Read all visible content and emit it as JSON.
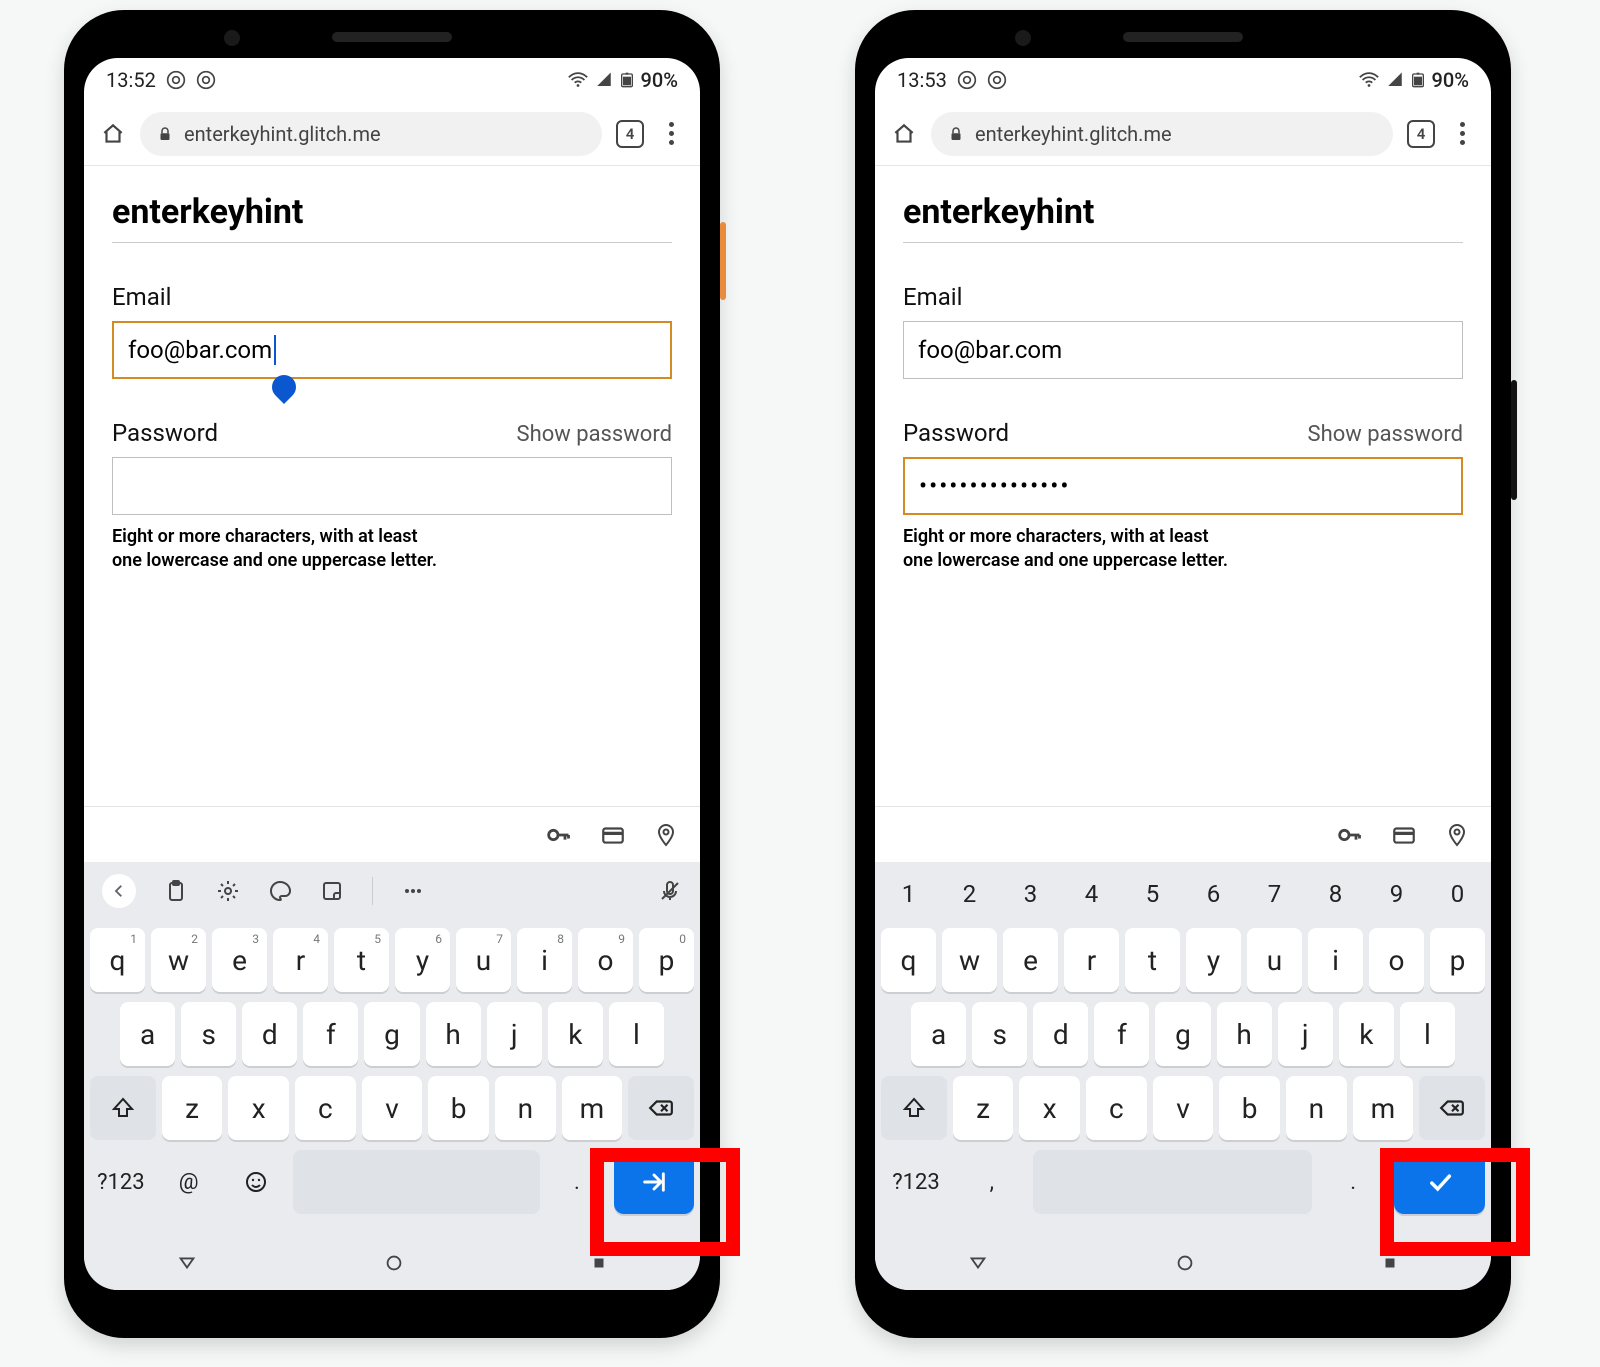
{
  "left": {
    "status": {
      "time": "13:52",
      "battery": "90%"
    },
    "omnibox": {
      "url": "enterkeyhint.glitch.me",
      "tab_count": "4"
    },
    "page": {
      "title": "enterkeyhint",
      "email_label": "Email",
      "email_value": "foo@bar.com",
      "password_label": "Password",
      "show_password": "Show password",
      "password_value": "",
      "hint_l1": "Eight or more characters, with at least",
      "hint_l2": "one lowercase and one uppercase letter."
    },
    "kb": {
      "r1": [
        "q",
        "w",
        "e",
        "r",
        "t",
        "y",
        "u",
        "i",
        "o",
        "p"
      ],
      "r1s": [
        "1",
        "2",
        "3",
        "4",
        "5",
        "6",
        "7",
        "8",
        "9",
        "0"
      ],
      "r2": [
        "a",
        "s",
        "d",
        "f",
        "g",
        "h",
        "j",
        "k",
        "l"
      ],
      "r3": [
        "z",
        "x",
        "c",
        "v",
        "b",
        "n",
        "m"
      ],
      "sym": "?123",
      "at": "@",
      "dot": ".",
      "action_kind": "next"
    }
  },
  "right": {
    "status": {
      "time": "13:53",
      "battery": "90%"
    },
    "omnibox": {
      "url": "enterkeyhint.glitch.me",
      "tab_count": "4"
    },
    "page": {
      "title": "enterkeyhint",
      "email_label": "Email",
      "email_value": "foo@bar.com",
      "password_label": "Password",
      "show_password": "Show password",
      "password_value": "•••••••••••••••",
      "hint_l1": "Eight or more characters, with at least",
      "hint_l2": "one lowercase and one uppercase letter."
    },
    "kb": {
      "num": [
        "1",
        "2",
        "3",
        "4",
        "5",
        "6",
        "7",
        "8",
        "9",
        "0"
      ],
      "r1": [
        "q",
        "w",
        "e",
        "r",
        "t",
        "y",
        "u",
        "i",
        "o",
        "p"
      ],
      "r2": [
        "a",
        "s",
        "d",
        "f",
        "g",
        "h",
        "j",
        "k",
        "l"
      ],
      "r3": [
        "z",
        "x",
        "c",
        "v",
        "b",
        "n",
        "m"
      ],
      "sym": "?123",
      "comma": ",",
      "dot": ".",
      "action_kind": "done"
    }
  }
}
